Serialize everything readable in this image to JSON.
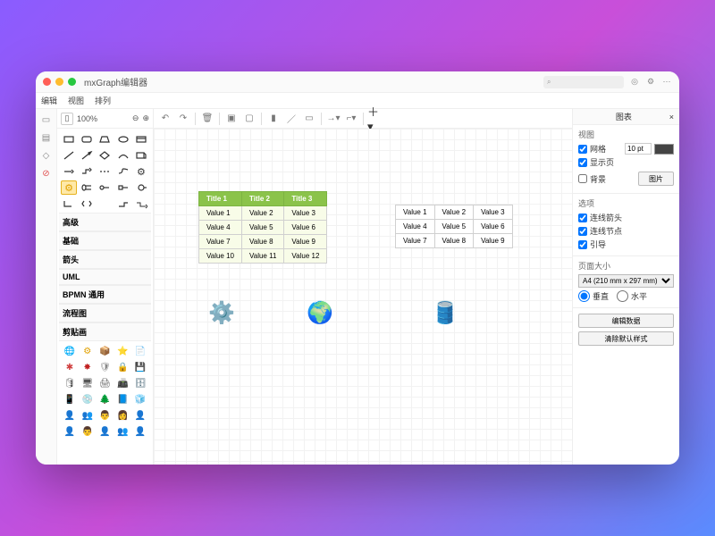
{
  "title": "mxGraph编辑器",
  "menu": [
    "编辑",
    "视图",
    "排列"
  ],
  "toolbar_left": {
    "zoom": "100%"
  },
  "categories": [
    "高级",
    "基础",
    "箭头",
    "UML",
    "BPMN 通用",
    "流程图",
    "剪贴画"
  ],
  "table1": {
    "headers": [
      "Title 1",
      "Title 2",
      "Title 3"
    ],
    "rows": [
      [
        "Value 1",
        "Value 2",
        "Value 3"
      ],
      [
        "Value 4",
        "Value 5",
        "Value 6"
      ],
      [
        "Value 7",
        "Value 8",
        "Value 9"
      ],
      [
        "Value 10",
        "Value 11",
        "Value 12"
      ]
    ]
  },
  "table2": {
    "rows": [
      [
        "Value 1",
        "Value 2",
        "Value 3"
      ],
      [
        "Value 4",
        "Value 5",
        "Value 6"
      ],
      [
        "Value 7",
        "Value 8",
        "Value 9"
      ]
    ]
  },
  "right": {
    "title": "图表",
    "view_label": "视图",
    "grid": "网格",
    "grid_size": "10 pt",
    "show_page": "显示页",
    "background": "背景",
    "bg_btn": "图片",
    "options_label": "选项",
    "arrow": "连线箭头",
    "node": "连线节点",
    "guide": "引导",
    "pagesize_label": "页面大小",
    "pagesize": "A4 (210 mm x 297 mm)",
    "orient_p": "垂直",
    "orient_l": "水平",
    "edit_data": "编辑数据",
    "clear_style": "清除默认样式"
  }
}
